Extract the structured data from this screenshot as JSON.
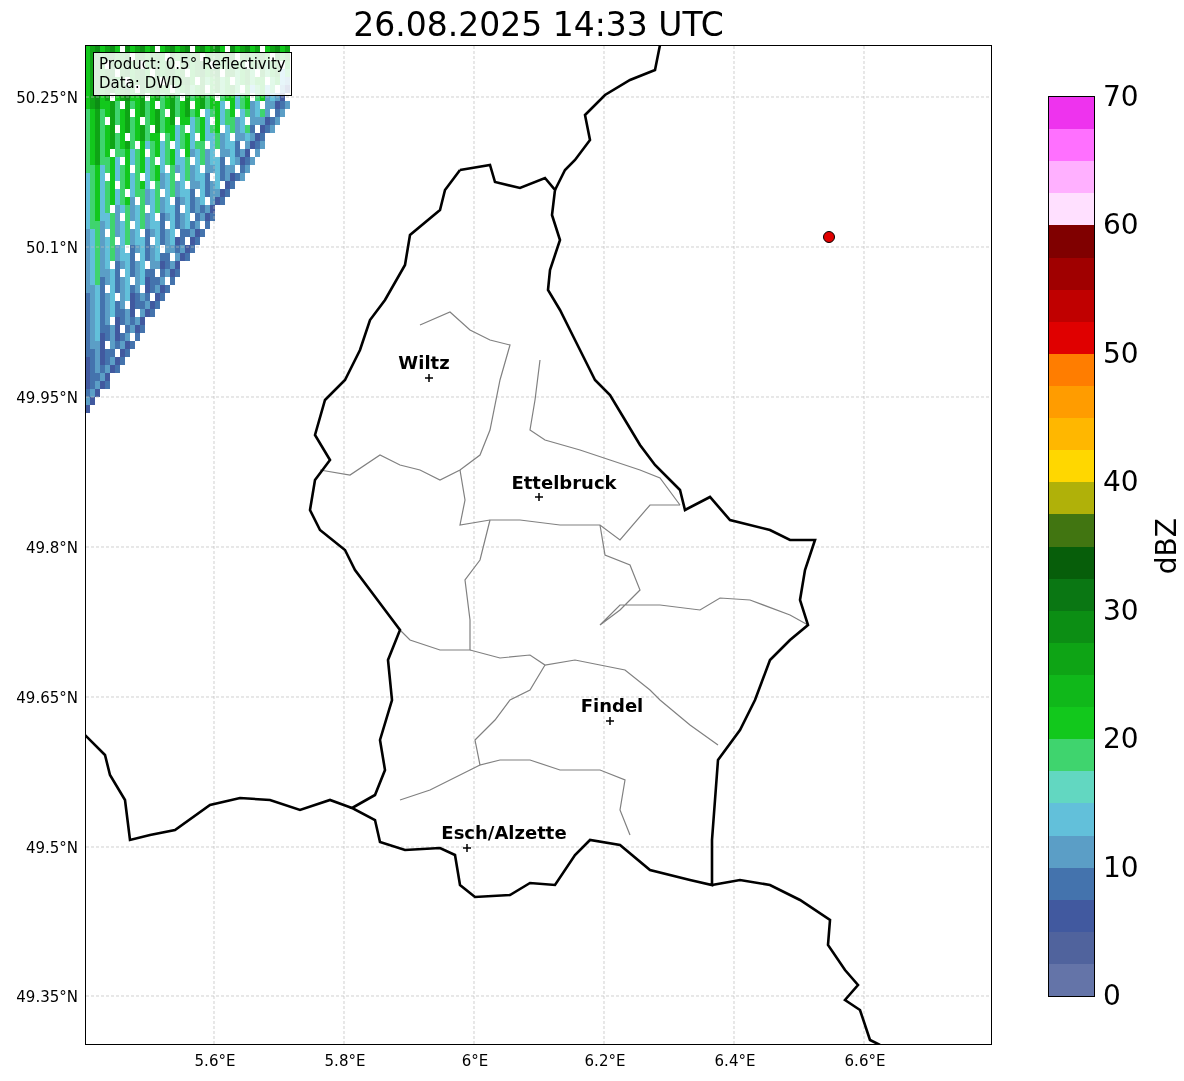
{
  "title": "26.08.2025 14:33 UTC",
  "map": {
    "info_box": [
      "Product: 0.5° Reflectivity",
      "Data: DWD"
    ],
    "y_ticks": [
      "50.25°N",
      "50.1°N",
      "49.95°N",
      "49.8°N",
      "49.65°N",
      "49.5°N",
      "49.35°N"
    ],
    "x_ticks": [
      "5.6°E",
      "5.8°E",
      "6°E",
      "6.2°E",
      "6.4°E",
      "6.6°E"
    ],
    "cities": [
      {
        "name": "Wiltz"
      },
      {
        "name": "Ettelbruck"
      },
      {
        "name": "Findel"
      },
      {
        "name": "Esch/Alzette"
      }
    ]
  },
  "colorbar": {
    "label": "dBZ",
    "ticks": [
      "70",
      "60",
      "50",
      "40",
      "30",
      "20",
      "10",
      "0"
    ],
    "bins": [
      {
        "color": "#ee33ee"
      },
      {
        "color": "#ff70ff"
      },
      {
        "color": "#ffb0ff"
      },
      {
        "color": "#ffe0ff"
      },
      {
        "color": "#800000"
      },
      {
        "color": "#a00000"
      },
      {
        "color": "#c00000"
      },
      {
        "color": "#e00000"
      },
      {
        "color": "#ff7d00"
      },
      {
        "color": "#ff9c00"
      },
      {
        "color": "#ffb700"
      },
      {
        "color": "#ffd700"
      },
      {
        "color": "#b0b109"
      },
      {
        "color": "#417511"
      },
      {
        "color": "#075e0a"
      },
      {
        "color": "#0a7713"
      },
      {
        "color": "#0c8e14"
      },
      {
        "color": "#0ea415"
      },
      {
        "color": "#10b81a"
      },
      {
        "color": "#12c81c"
      },
      {
        "color": "#3fd46e"
      },
      {
        "color": "#62d7c1"
      },
      {
        "color": "#62c0da"
      },
      {
        "color": "#5b9ec6"
      },
      {
        "color": "#4473ad"
      },
      {
        "color": "#41599f"
      },
      {
        "color": "#50639d"
      },
      {
        "color": "#6474a8"
      }
    ]
  }
}
